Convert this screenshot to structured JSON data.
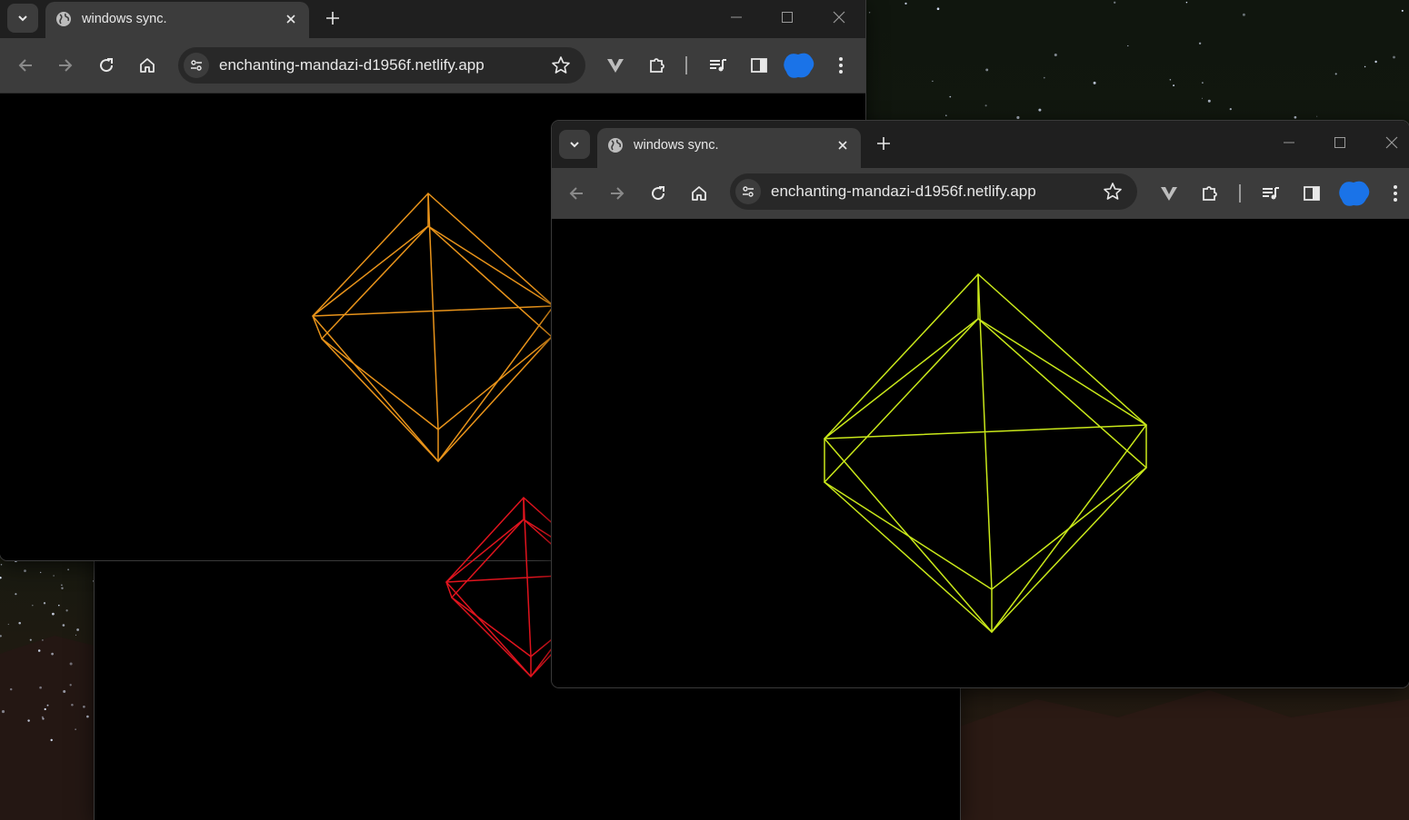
{
  "browser": {
    "tab_title": "windows sync.",
    "url": "enchanting-mandazi-d1956f.netlify.app"
  },
  "colors": {
    "orange_octahedron": "#e8931a",
    "red_octahedron": "#e0141e",
    "yellow_octahedron": "#c9e81a",
    "profile_blob": "#1a73e8"
  },
  "icons": {
    "tab_search": "chevron-down-icon",
    "favicon": "globe-icon",
    "tab_close": "close-icon",
    "new_tab": "plus-icon",
    "minimize": "minimize-icon",
    "maximize": "maximize-icon",
    "close_window": "close-window-icon",
    "back": "arrow-left-icon",
    "forward": "arrow-right-icon",
    "reload": "reload-icon",
    "home": "home-icon",
    "site_info": "tune-icon",
    "bookmark": "star-icon",
    "extension_v": "v-logo-icon",
    "extensions": "puzzle-icon",
    "media": "media-playlist-icon",
    "side_panel": "side-panel-icon",
    "profile": "profile-avatar-icon",
    "menu": "more-vertical-icon"
  }
}
